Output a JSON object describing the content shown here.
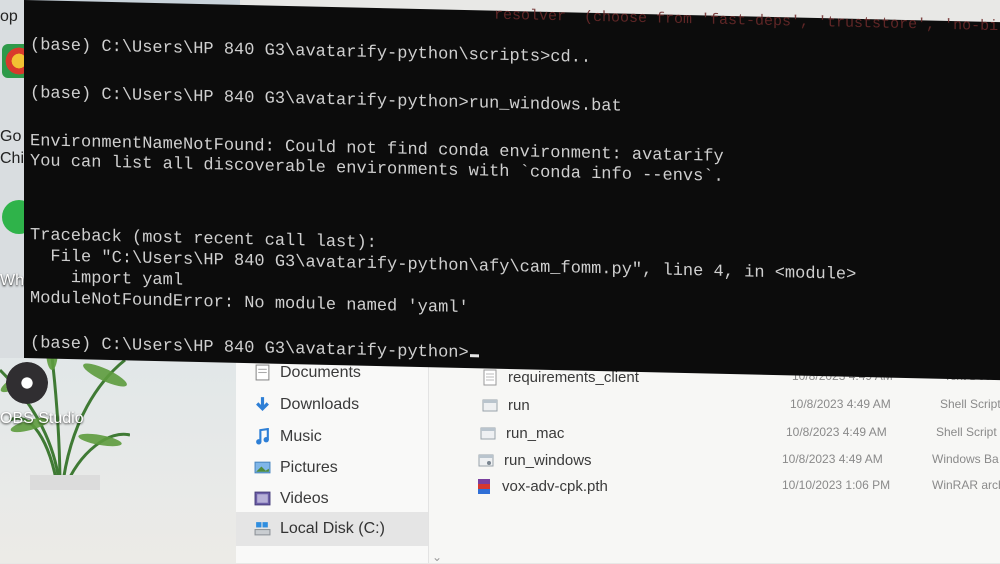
{
  "terminal": {
    "faint_top": "resolver  (choose from 'fast-deps', 'truststore', 'no-bi",
    "lines": [
      "(base) C:\\Users\\HP 840 G3\\avatarify-python\\scripts>cd..",
      "(base) C:\\Users\\HP 840 G3\\avatarify-python>run_windows.bat",
      "EnvironmentNameNotFound: Could not find conda environment: avatarify",
      "You can list all discoverable environments with `conda info --envs`.",
      "Traceback (most recent call last):",
      "  File \"C:\\Users\\HP 840 G3\\avatarify-python\\afy\\cam_fomm.py\", line 4, in <module>",
      "    import yaml",
      "ModuleNotFoundError: No module named 'yaml'",
      "(base) C:\\Users\\HP 840 G3\\avatarify-python>"
    ]
  },
  "desktop": {
    "stub_labels": [
      "op",
      "Go",
      "Chi",
      "Wha"
    ],
    "obs_label": "OBS Studio"
  },
  "explorer": {
    "nav_items": [
      "Documents",
      "Downloads",
      "Music",
      "Pictures",
      "Videos",
      "Local Disk (C:)"
    ],
    "files": [
      {
        "name": "requirements_client",
        "date": "10/8/2023 4:49 AM",
        "type": "Text Docu"
      },
      {
        "name": "run",
        "date": "10/8/2023 4:49 AM",
        "type": "Shell Script"
      },
      {
        "name": "run_mac",
        "date": "10/8/2023 4:49 AM",
        "type": "Shell Script"
      },
      {
        "name": "run_windows",
        "date": "10/8/2023 4:49 AM",
        "type": "Windows Ba"
      },
      {
        "name": "vox-adv-cpk.pth",
        "date": "10/10/2023 1:06 PM",
        "type": "WinRAR arch"
      }
    ]
  },
  "colors": {
    "terminal_bg": "#0c0c0c",
    "terminal_fg": "#cfcfcf",
    "explorer_bg": "#f7f7f5"
  }
}
